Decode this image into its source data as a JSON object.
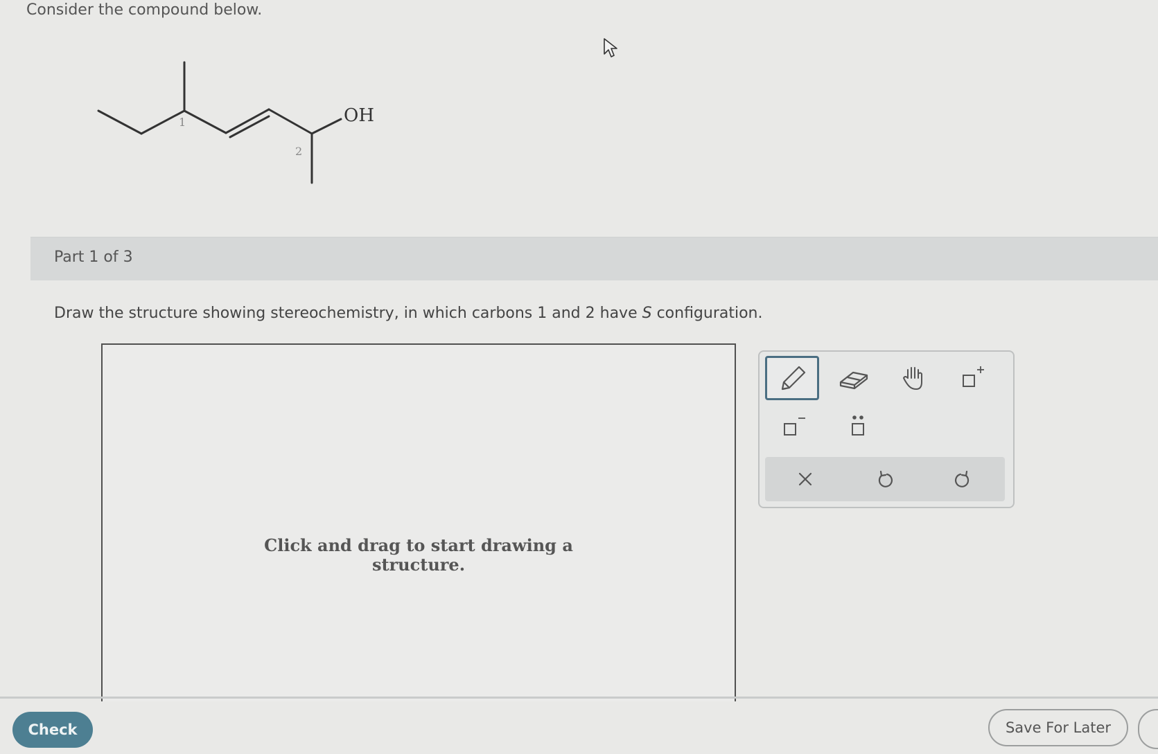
{
  "question": {
    "prompt": "Consider the compound below.",
    "molecule": {
      "hydroxyl_label": "OH",
      "carbon_labels": [
        "1",
        "2"
      ]
    }
  },
  "part": {
    "label": "Part 1 of 3"
  },
  "instructions": {
    "before": "Draw the structure showing stereochemistry, in which carbons 1 and 2 have ",
    "config_letter": "S",
    "after": " configuration."
  },
  "canvas": {
    "hint_line1": "Click and drag to start drawing a",
    "hint_line2": "structure."
  },
  "toolbar": {
    "tools": [
      {
        "name": "pencil-icon",
        "active": true
      },
      {
        "name": "eraser-icon",
        "active": false
      },
      {
        "name": "hand-icon",
        "active": false
      },
      {
        "name": "positive-charge-icon",
        "active": false
      },
      {
        "name": "negative-charge-icon",
        "active": false
      },
      {
        "name": "lone-pair-icon",
        "active": false
      }
    ],
    "actions": [
      "clear-icon",
      "undo-icon",
      "redo-icon"
    ],
    "accent_color": "#4a6e82"
  },
  "footer": {
    "check_label": "Check",
    "save_label": "Save For Later",
    "check_color": "#4d7f92"
  }
}
